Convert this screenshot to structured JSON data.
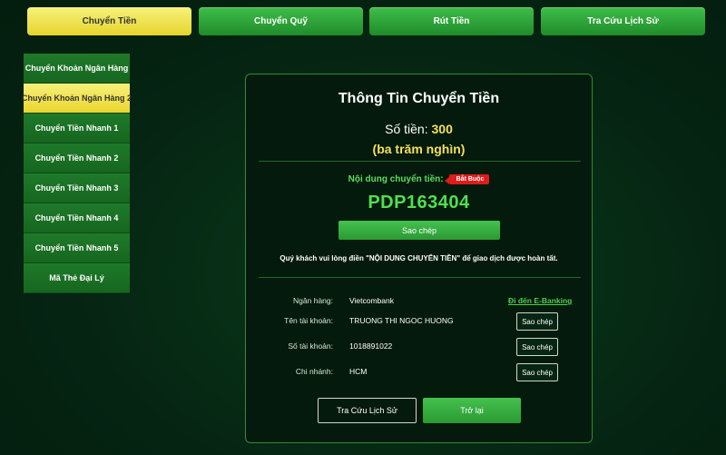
{
  "tabs": [
    {
      "label": "Chuyển Tiền",
      "active": true
    },
    {
      "label": "Chuyển Quỹ",
      "active": false
    },
    {
      "label": "Rút Tiền",
      "active": false
    },
    {
      "label": "Tra Cứu Lịch Sử",
      "active": false
    }
  ],
  "sidebar": {
    "items": [
      {
        "label": "Chuyển Khoản Ngân Hàng",
        "active": false
      },
      {
        "label": "Chuyển Khoản Ngân Hàng 2",
        "active": true
      },
      {
        "label": "Chuyển Tiền Nhanh 1",
        "active": false
      },
      {
        "label": "Chuyển Tiền Nhanh 2",
        "active": false
      },
      {
        "label": "Chuyển Tiền Nhanh 3",
        "active": false
      },
      {
        "label": "Chuyển Tiền Nhanh 4",
        "active": false
      },
      {
        "label": "Chuyển Tiền Nhanh 5",
        "active": false
      },
      {
        "label": "Mã Thẻ Đại Lý",
        "active": false
      }
    ]
  },
  "panel": {
    "title": "Thông Tin Chuyển Tiền",
    "amount_label": "Số tiền:",
    "amount_value": "300",
    "amount_words": "(ba trăm nghìn)",
    "content_label": "Nội dung chuyển tiền:",
    "required_badge": "Bắt Buộc",
    "transfer_code": "PDP163404",
    "copy_label": "Sao chép",
    "notice": "Quý khách vui lòng điền \"NỘI DUNG CHUYỂN TIỀN\" để giao dịch được hoàn tất.",
    "bank_label": "Ngân hàng:",
    "bank_value": "Vietcombank",
    "ebanking_link": "Đi đến E-Banking",
    "account_name_label": "Tên tài khoản:",
    "account_name_value": "TRUONG THI NGOC HUONG",
    "account_number_label": "Số tài khoản:",
    "account_number_value": "1018891022",
    "branch_label": "Chi nhánh:",
    "branch_value": "HCM",
    "copy_small_label": "Sao chép",
    "history_button": "Tra Cứu Lịch Sử",
    "back_button": "Trở lại"
  },
  "colors": {
    "accent_green": "#3fbd4a",
    "active_yellow": "#ead52e",
    "highlight_yellow": "#f4e25a",
    "code_green": "#4fe04f",
    "badge_red": "#e01b1b"
  }
}
